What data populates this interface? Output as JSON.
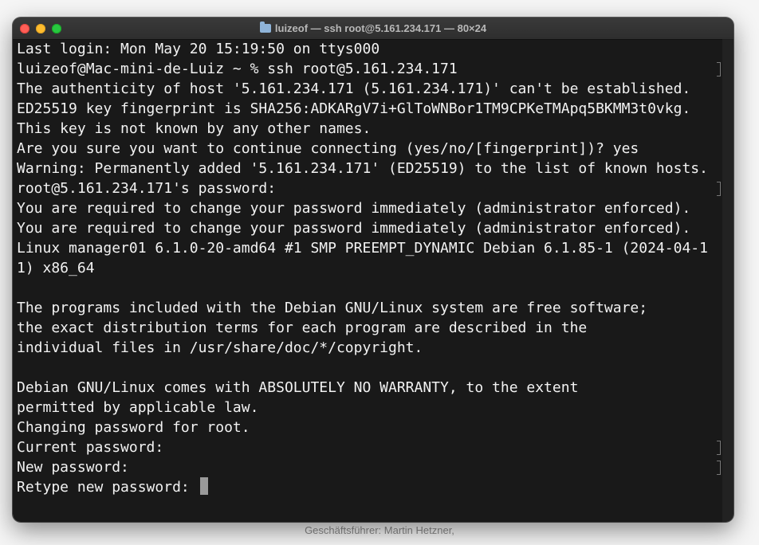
{
  "window": {
    "title": "luizeof — ssh root@5.161.234.171 — 80×24"
  },
  "terminal": {
    "lines": [
      "Last login: Mon May 20 15:19:50 on ttys000",
      "luizeof@Mac-mini-de-Luiz ~ % ssh root@5.161.234.171",
      "The authenticity of host '5.161.234.171 (5.161.234.171)' can't be established.",
      "ED25519 key fingerprint is SHA256:ADKARgV7i+GlToWNBor1TM9CPKeTMApq5BKMM3t0vkg.",
      "This key is not known by any other names.",
      "Are you sure you want to continue connecting (yes/no/[fingerprint])? yes",
      "Warning: Permanently added '5.161.234.171' (ED25519) to the list of known hosts.",
      "root@5.161.234.171's password:",
      "You are required to change your password immediately (administrator enforced).",
      "You are required to change your password immediately (administrator enforced).",
      "Linux manager01 6.1.0-20-amd64 #1 SMP PREEMPT_DYNAMIC Debian 6.1.85-1 (2024-04-1",
      "1) x86_64",
      "",
      "The programs included with the Debian GNU/Linux system are free software;",
      "the exact distribution terms for each program are described in the",
      "individual files in /usr/share/doc/*/copyright.",
      "",
      "Debian GNU/Linux comes with ABSOLUTELY NO WARRANTY, to the extent",
      "permitted by applicable law.",
      "Changing password for root.",
      "Current password:",
      "New password:",
      "Retype new password: "
    ]
  },
  "background": {
    "footer_text": "Geschäftsführer: Martin Hetzner,"
  },
  "colors": {
    "terminal_bg": "#080808",
    "terminal_fg": "#f2f2f2",
    "close": "#ff5f57",
    "minimize": "#febc2e",
    "maximize": "#28c840"
  }
}
